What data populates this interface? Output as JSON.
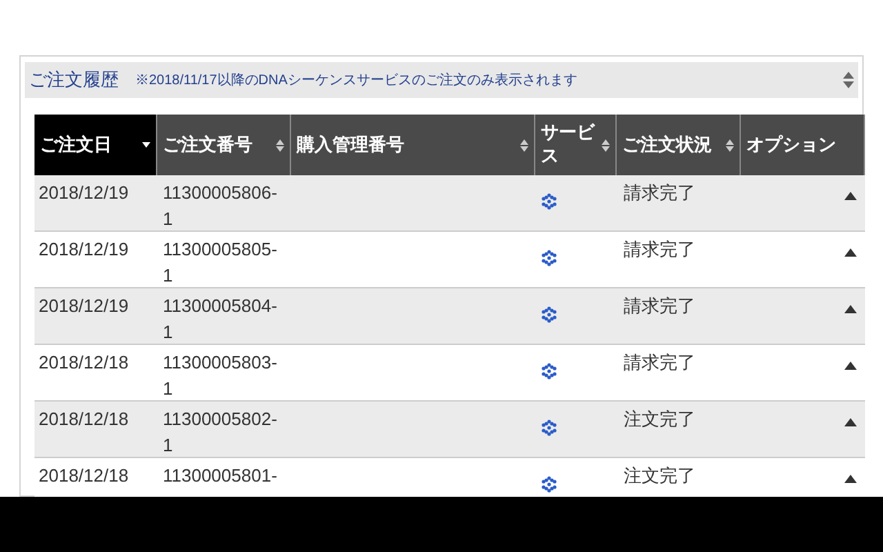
{
  "panel": {
    "title": "ご注文履歴",
    "note": "※2018/11/17以降のDNAシーケンスサービスのご注文のみ表示されます"
  },
  "table": {
    "columns": [
      {
        "label": "ご注文日",
        "sorted": true,
        "sortable": true
      },
      {
        "label": "ご注文番号",
        "sorted": false,
        "sortable": true
      },
      {
        "label": "購入管理番号",
        "sorted": false,
        "sortable": true
      },
      {
        "label": "サービス",
        "sorted": false,
        "sortable": true
      },
      {
        "label": "ご注文状況",
        "sorted": false,
        "sortable": true
      },
      {
        "label": "オプション",
        "sorted": false,
        "sortable": false
      }
    ],
    "rows": [
      {
        "date": "2018/12/19",
        "order_no": "11300005806-1",
        "status": "請求完了"
      },
      {
        "date": "2018/12/19",
        "order_no": "11300005805-1",
        "status": "請求完了"
      },
      {
        "date": "2018/12/19",
        "order_no": "11300005804-1",
        "status": "請求完了"
      },
      {
        "date": "2018/12/18",
        "order_no": "11300005803-1",
        "status": "請求完了"
      },
      {
        "date": "2018/12/18",
        "order_no": "11300005802-1",
        "status": "注文完了"
      },
      {
        "date": "2018/12/18",
        "order_no": "11300005801-",
        "status": "注文完了"
      }
    ]
  }
}
